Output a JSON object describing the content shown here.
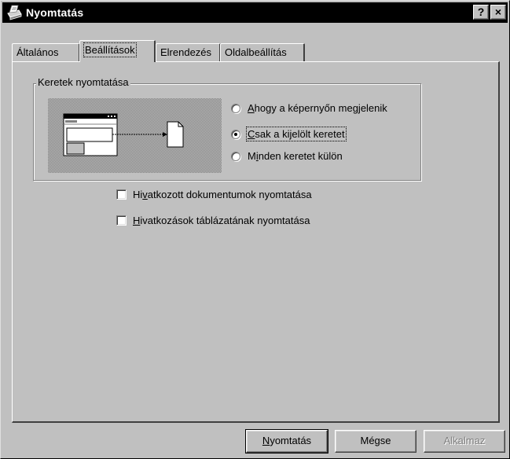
{
  "window": {
    "title": "Nyomtatás",
    "help_label": "?",
    "close_label": "×"
  },
  "tabs": [
    {
      "label": "Általános",
      "active": false
    },
    {
      "label": "Beállítások",
      "active": true
    },
    {
      "label": "Elrendezés",
      "active": false
    },
    {
      "label": "Oldalbeállítás",
      "active": false
    }
  ],
  "frames_group": {
    "legend": "Keretek nyomtatása",
    "options": [
      {
        "label": "Ahogy a képernyőn megjelenik",
        "accel": "A",
        "checked": false
      },
      {
        "label": "Csak a kijelölt keretet",
        "accel": "C",
        "checked": true
      },
      {
        "label": "Minden keretet külön",
        "accel": "i",
        "checked": false
      }
    ]
  },
  "checkboxes": [
    {
      "label": "Hivatkozott dokumentumok nyomtatása",
      "accel": "v",
      "checked": false
    },
    {
      "label": "Hivatkozások táblázatának nyomtatása",
      "accel": "H",
      "checked": false
    }
  ],
  "buttons": {
    "print": {
      "label": "Nyomtatás",
      "accel": "N"
    },
    "cancel": {
      "label": "Mégse"
    },
    "apply": {
      "label": "Alkalmaz",
      "disabled": true
    }
  }
}
